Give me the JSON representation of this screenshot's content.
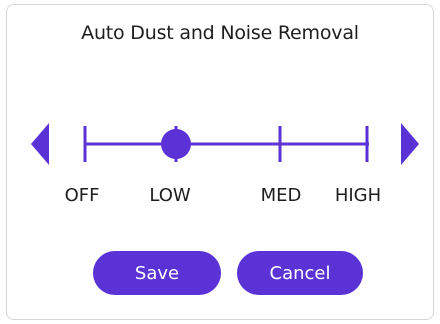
{
  "dialog": {
    "title": "Auto Dust and Noise Removal"
  },
  "slider": {
    "levels": [
      "OFF",
      "LOW",
      "MED",
      "HIGH"
    ],
    "selected": "LOW",
    "selected_index": 1
  },
  "buttons": {
    "save_label": "Save",
    "cancel_label": "Cancel"
  },
  "icons": {
    "left": "arrow-left-icon",
    "right": "arrow-right-icon"
  },
  "colors": {
    "accent": "#5b32d6",
    "text": "#1e1e1e",
    "border": "#d6d6d6",
    "button_text": "#ffffff"
  }
}
